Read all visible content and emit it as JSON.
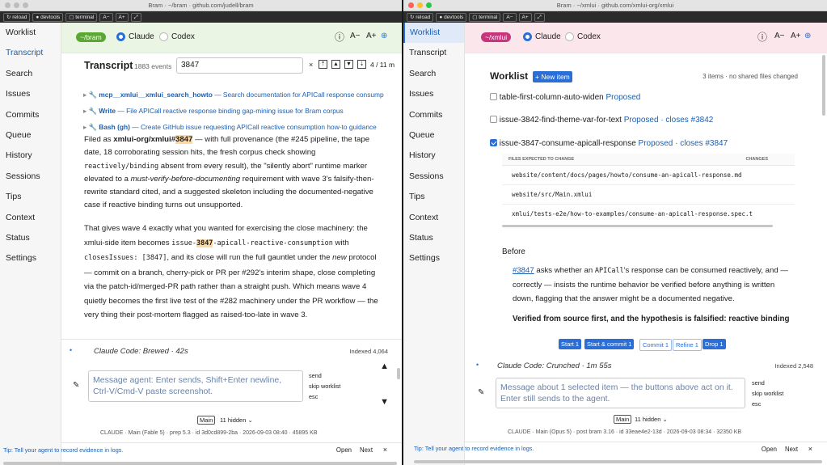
{
  "left": {
    "title": "Bram · ~/bram · github.com/judell/bram",
    "toolbar": [
      "reload",
      "devtools",
      "terminal",
      "A−",
      "A+",
      ""
    ],
    "sidebar": [
      "Worklist",
      "Transcript",
      "Search",
      "Issues",
      "Commits",
      "Queue",
      "History",
      "Sessions",
      "Tips",
      "Context",
      "Status",
      "Settings"
    ],
    "repo_pill": "~/bram",
    "agent_claude": "Claude",
    "agent_codex": "Codex",
    "transcript_title": "Transcript",
    "events": "1883 events",
    "search_value": "3847",
    "match_count": "4 / 11 m",
    "tools": [
      {
        "name": "mcp__xmlui__xmlui_search_howto",
        "desc": "— Search documentation for APICall response consump"
      },
      {
        "name": "Write",
        "desc": "— File APICall reactive response binding gap-mining issue for Bram corpus"
      },
      {
        "name": "Bash (gh)",
        "desc": "— Create GitHub issue requesting APICall reactive consumption how-to guidance"
      }
    ],
    "p1": {
      "a": "Filed as ",
      "b": "xmlui-org/xmlui#",
      "c": "3847",
      "d": " — with full provenance (the #245 pipeline, the tape date, 18 corroborating session hits, the fresh corpus check showing ",
      "e": "reactively/binding",
      "f": " absent from every result), the \"silently abort\" runtime marker elevated to a ",
      "g": "must-verify-before-documenting",
      "h": " requirement with wave 3's falsify-then-rewrite standard cited, and a suggested skeleton including the documented-negative case if reactive binding turns out unsupported."
    },
    "p2": {
      "a": "That gives wave 4 exactly what you wanted for exercising the close machinery: the xmlui-side item becomes ",
      "b": "issue-",
      "c": "3847",
      "d": "-apicall-reactive-consumption",
      "e": " with ",
      "f": "closesIssues: [3847]",
      "g": ", and its close will run the full gauntlet under the ",
      "h": "new",
      "i": " protocol — commit on a branch, cherry-pick or PR per #292's interim shape, close completing via the patch-id/merged-PR path rather than a straight push. Which means wave 4 quietly becomes the first live test of the #282 machinery under the PR workflow — the very thing their post-mortem flagged as raised-too-late in wave 3."
    },
    "status": "Claude Code: Brewed · 42s",
    "indexed": "Indexed 4,064",
    "send": "send",
    "skip": "skip worklist",
    "esc": "esc",
    "placeholder": "Message agent: Enter sends, Shift+Enter newline, Ctrl-V/Cmd-V paste screenshot.",
    "branch": "Main",
    "hidden": "11 hidden",
    "meta": "CLAUDE · Main (Fable 5) · prep 5.3 · id 3d0cd899-2ba · 2026-09-03 08:40 · 45895 KB",
    "tip": "Tip: Tell your agent to record evidence in logs.",
    "open": "Open",
    "next": "Next"
  },
  "right": {
    "title": "Bram · ~/xmlui · github.com/xmlui-org/xmlui",
    "toolbar": [
      "reload",
      "devtools",
      "terminal",
      "A−",
      "A+",
      ""
    ],
    "sidebar": [
      "Worklist",
      "Transcript",
      "Search",
      "Issues",
      "Commits",
      "Queue",
      "History",
      "Sessions",
      "Tips",
      "Context",
      "Status",
      "Settings"
    ],
    "repo_pill": "~/xmlui",
    "agent_claude": "Claude",
    "agent_codex": "Codex",
    "worklist_title": "Worklist",
    "new_item": "+ New item",
    "summary": "3 items · no shared files changed",
    "items": [
      {
        "name": "table-first-column-auto-widen",
        "status": "Proposed",
        "checked": false
      },
      {
        "name": "issue-3842-find-theme-var-for-text",
        "status": "Proposed · closes #3842",
        "checked": false
      },
      {
        "name": "issue-3847-consume-apicall-response",
        "status": "Proposed · closes #3847",
        "checked": true
      }
    ],
    "files_header": "FILES EXPECTED TO CHANGE",
    "changes_header": "CHANGES",
    "files": [
      "website/content/docs/pages/howto/consume-an-apicall-response.md",
      "website/src/Main.xmlui",
      "xmlui/tests-e2e/how-to-examples/consume-an-apicall-response.spec.t"
    ],
    "before": "Before",
    "b1": {
      "a": "#3847",
      "b": " asks whether an ",
      "c": "APICall",
      "d": "'s response can be consumed reactively, and — correctly — insists the runtime behavior be verified before anything is written down, flagging that the answer might be a documented negative."
    },
    "b2": "Verified from source first, and the hypothesis is falsified: reactive binding IS supported",
    "actions": [
      "Start 1",
      "Start & commit 1",
      "Commit 1",
      "Refine 1",
      "Drop 1"
    ],
    "status": "Claude Code: Crunched · 1m 55s",
    "indexed": "Indexed 2,548",
    "send": "send",
    "skip": "skip worklist",
    "esc": "esc",
    "placeholder": "Message about 1 selected item — the buttons above act on it. Enter still sends to the agent.",
    "branch": "Main",
    "hidden": "11 hidden",
    "meta": "CLAUDE · Main (Opus 5) · post bram 3.16 · id 33eae4e2-13d · 2026-09-03 08:34 · 32350 KB",
    "tip": "Tip: Tell your agent to record evidence in logs.",
    "open": "Open",
    "next": "Next"
  },
  "colors": {
    "accent": "#2b6fd6",
    "pill_left": "#5aa832",
    "pill_right": "#c8357d",
    "bar_left": "#eaf6e3",
    "bar_right": "#fbe6ec",
    "highlight": "#ffd9a3"
  }
}
